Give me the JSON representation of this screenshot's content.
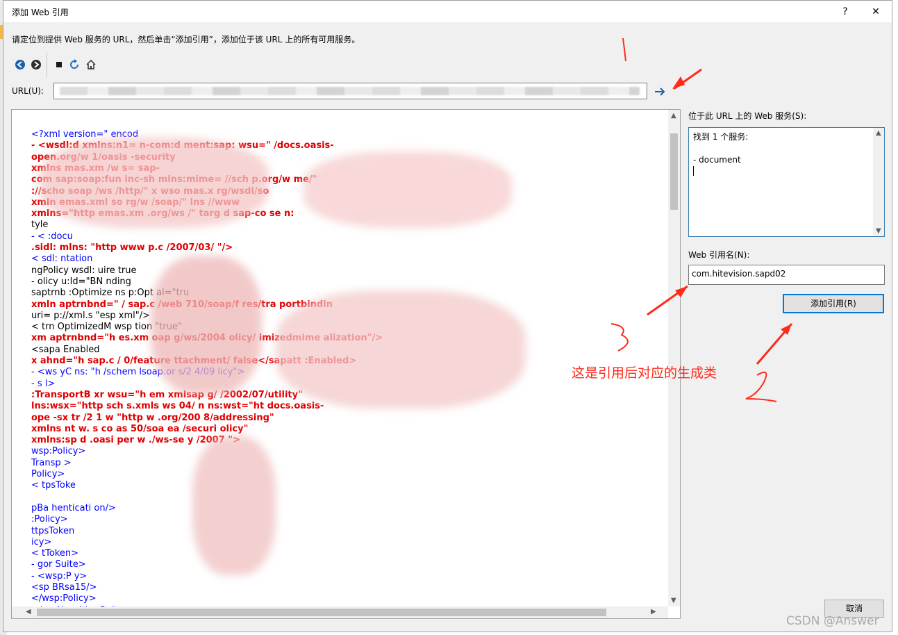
{
  "dialog": {
    "title": "添加 Web 引用",
    "help_label": "?",
    "close_label": "✕",
    "instruction": "请定位到提供 Web 服务的 URL，然后单击“添加引用”，添加位于该 URL 上的所有可用服务。"
  },
  "toolbar": {
    "back_icon": "back-arrow-icon",
    "forward_icon": "forward-arrow-icon",
    "stop_icon": "stop-icon",
    "refresh_icon": "refresh-icon",
    "home_icon": "home-icon"
  },
  "url": {
    "label": "URL(U):",
    "value": ""
  },
  "xml": {
    "lines": [
      {
        "t": "<?xml version=\"   encod",
        "c": "c-blue"
      },
      {
        "t": "- <wsdl:d      xmlns:n1=  n-com:d  ment:sap:  wsu=\"   /docs.oasis-",
        "c": "c-red"
      },
      {
        "t": "open.org/w      1/oasis   -security",
        "c": "c-red"
      },
      {
        "t": "xmlns   mas.xm          /w      s=  sap-",
        "c": "c-red"
      },
      {
        "t": "com    sap:soap:fun  inc-sh  mlns:mime=  //sch   p.org/w   me/\"",
        "c": "c-red"
      },
      {
        "t": "  ://scho  soap  /ws  /http/\" x   wso     mas.x  rg/wsdl/so",
        "c": "c-red"
      },
      {
        "t": "xmln    emas.xml  so  rg/w  /soap/\"  lns   //www   ",
        "c": "c-red"
      },
      {
        "t": "xmlns=\"http  emas.xm  .org/ws  /\" targ     d  sap-co    se   n:",
        "c": "c-red"
      },
      {
        "t": "tyle",
        "c": "c-black"
      },
      {
        "t": "  - <   :docu    ",
        "c": "c-blue"
      },
      {
        "t": "       .sidl:   mlns:     \"http    www   p.c   /2007/03/  \"/>",
        "c": "c-red"
      },
      {
        "t": "    <  sdl:     ntation",
        "c": "c-blue"
      },
      {
        "t": "       ngPolicy wsdl:   uire    true",
        "c": "c-black"
      },
      {
        "t": "  -     olicy   u:Id=\"BN   nding",
        "c": "c-black"
      },
      {
        "t": "        saptrnb  :Optimize   ns   p:Opt   al=\"tru",
        "c": "c-black"
      },
      {
        "t": "          xmln   aptrnbnd=\"    /   sap.c   /web   710/soap/f   res/tra   portbindin",
        "c": "c-red"
      },
      {
        "t": "          uri=  p://xml.s          \"esp   xml\"/>",
        "c": "c-black"
      },
      {
        "t": "      <   trn   OptimizedM       wsp  tion   \"true\"",
        "c": "c-black"
      },
      {
        "t": "          xm   aptrnbnd=\"h      es.xm  oap  g/ws/2004   olicy/   imizedmime   alization\"/>",
        "c": "c-red"
      },
      {
        "t": "      <sapa       Enabled",
        "c": "c-black"
      },
      {
        "t": "          x     ahnd=\"h       sap.c   /  0/feature   ttachment/  false</sapatt   :Enabled>",
        "c": "c-red"
      },
      {
        "t": "  - <ws    yC   ns:    \"h   /schem   lsoap.or  s/2  4/09  licy\">",
        "c": "c-blue"
      },
      {
        "t": "    -   s   l>",
        "c": "c-blue"
      },
      {
        "t": "          :TransportB   xr  wsu=\"h   em   xmlsap   g/   /2002/07/utility\"",
        "c": "c-red"
      },
      {
        "t": "          lns:wsx=\"http  sch   s.xmls   ws   04/  n   ns:wst=\"ht   docs.oasis-",
        "c": "c-red"
      },
      {
        "t": "          ope       -sx    tr   /2   1     w   \"http   w   .org/200  8/addressing\"",
        "c": "c-red"
      },
      {
        "t": "          xmlns       nt     w. s   co    as  50/soa   ea   /securi   olicy\"",
        "c": "c-red"
      },
      {
        "t": "          xmlns:sp      d   .oasi   per    w   ./ws-se   y   /2007  \">",
        "c": "c-red"
      },
      {
        "t": "             wsp:Policy>",
        "c": "c-blue"
      },
      {
        "t": "               Transp     >",
        "c": "c-blue"
      },
      {
        "t": "                    Policy>",
        "c": "c-blue"
      },
      {
        "t": "                 <    tpsToke",
        "c": "c-blue"
      },
      {
        "t": "",
        "c": "c-blue"
      },
      {
        "t": "                        pBa     henticati on/>",
        "c": "c-blue"
      },
      {
        "t": "                       :Policy>",
        "c": "c-blue"
      },
      {
        "t": "                       ttpsToken",
        "c": "c-blue"
      },
      {
        "t": "                      icy>",
        "c": "c-blue"
      },
      {
        "t": "                <      tToken>",
        "c": "c-blue"
      },
      {
        "t": "             -     gor     Suite>",
        "c": "c-blue"
      },
      {
        "t": "              - <wsp:P    y>",
        "c": "c-blue"
      },
      {
        "t": "                  <sp       BRsa15/>",
        "c": "c-blue"
      },
      {
        "t": "                </wsp:Policy>",
        "c": "c-blue"
      },
      {
        "t": "             </sp:AlgorithmSuite>",
        "c": "c-blue"
      }
    ]
  },
  "services": {
    "label": "位于此 URL 上的 Web 服务(S):",
    "line1": "找到 1 个服务:",
    "line2": "- document"
  },
  "reference": {
    "label": "Web 引用名(N):",
    "value": "com.hitevision.sapd02"
  },
  "buttons": {
    "add": "添加引用(R)",
    "cancel": "取消"
  },
  "annotations": {
    "num1": "1",
    "num2": "2",
    "num3": "3",
    "note": "这是引用后对应的生成类"
  },
  "watermark": "CSDN @Answer"
}
